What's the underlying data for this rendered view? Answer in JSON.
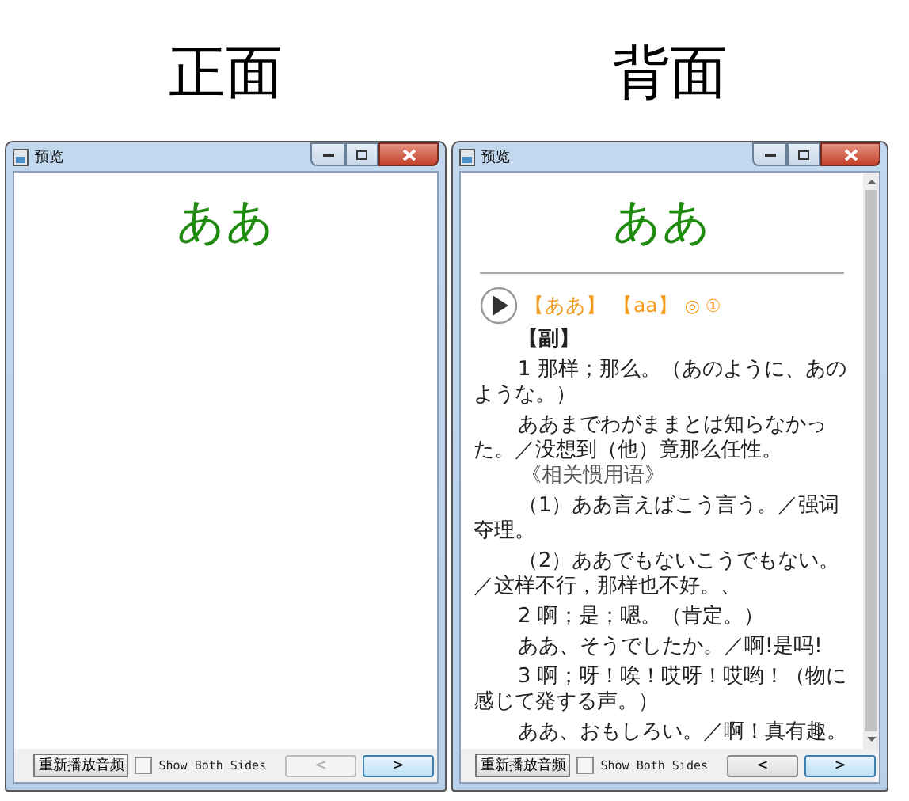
{
  "panels": [
    {
      "heading": "正面",
      "window": {
        "title": "预览"
      },
      "word": "ああ",
      "scrollbar": false,
      "footer": {
        "replay_button": "重新播放音频",
        "show_both_sides": {
          "label": "Show Both Sides",
          "checked": false
        },
        "prev": {
          "label": "<",
          "disabled": true
        },
        "next": {
          "label": ">",
          "disabled": false
        }
      }
    },
    {
      "heading": "背面",
      "window": {
        "title": "预览"
      },
      "word": "ああ",
      "scrollbar": true,
      "entry": {
        "reading": "【ああ】",
        "romaji": "【aa】",
        "marks": "◎ ①",
        "paragraphs": [
          {
            "kind": "pos",
            "text": "【副】"
          },
          {
            "kind": "sense",
            "text": "1 那样；那么。（あのように、あのような。）"
          },
          {
            "kind": "example",
            "text": "ああまでわがままとは知らなかった。／没想到（他）竟那么任性。"
          },
          {
            "kind": "related",
            "text": "《相关惯用语》"
          },
          {
            "kind": "example",
            "text": "（1）ああ言えばこう言う。／强词夺理。"
          },
          {
            "kind": "example",
            "text": "（2）ああでもないこうでもない。"
          },
          {
            "kind": "plain",
            "text": "／这样不行，那样也不好。、"
          },
          {
            "kind": "sense",
            "text": "2 啊；是；嗯。（肯定。）"
          },
          {
            "kind": "example",
            "text": "ああ、そうでしたか。／啊!是吗!"
          },
          {
            "kind": "sense",
            "text": "3 啊；呀！唉！哎呀！哎哟！（物に感じて発する声。）"
          },
          {
            "kind": "example",
            "text": "ああ、おもしろい。／啊！真有趣。"
          }
        ]
      },
      "footer": {
        "replay_button": "重新播放音频",
        "show_both_sides": {
          "label": "Show Both Sides",
          "checked": false
        },
        "prev": {
          "label": "<",
          "disabled": false
        },
        "next": {
          "label": ">",
          "disabled": false
        }
      }
    }
  ]
}
